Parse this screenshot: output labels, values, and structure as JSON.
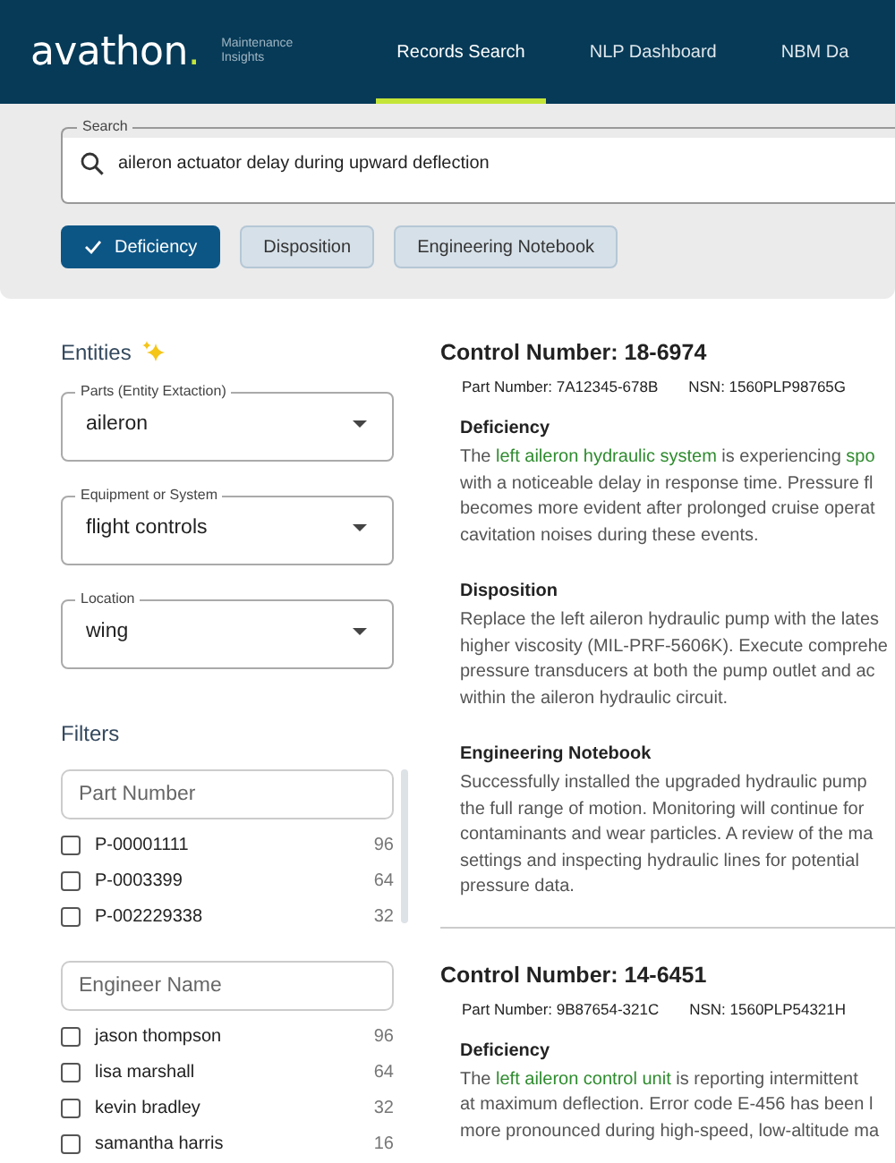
{
  "header": {
    "logo": "avathon",
    "logo_dot": ".",
    "subtitle_lines": [
      "Maintenance",
      "Insights"
    ],
    "nav": [
      {
        "label": "Records Search",
        "selected": true
      },
      {
        "label": "NLP Dashboard",
        "selected": false
      },
      {
        "label": "NBM Da",
        "selected": false
      }
    ]
  },
  "search": {
    "label": "Search",
    "value": "aileron actuator delay during upward deflection",
    "chips": [
      {
        "label": "Deficiency",
        "selected": true
      },
      {
        "label": "Disposition",
        "selected": false
      },
      {
        "label": "Engineering Notebook",
        "selected": false
      }
    ]
  },
  "entities": {
    "title": "Entities",
    "dropdowns": [
      {
        "label": "Parts (Entity Extaction)",
        "value": "aileron"
      },
      {
        "label": "Equipment or System",
        "value": "flight controls"
      },
      {
        "label": "Location",
        "value": "wing"
      }
    ]
  },
  "filters": {
    "title": "Filters",
    "groups": [
      {
        "placeholder": "Part Number",
        "options": [
          {
            "label": "P-00001111",
            "count": "96",
            "checked": false
          },
          {
            "label": "P-0003399",
            "count": "64",
            "checked": false
          },
          {
            "label": "P-002229338",
            "count": "32",
            "checked": false
          }
        ]
      },
      {
        "placeholder": "Engineer Name",
        "options": [
          {
            "label": "jason thompson",
            "count": "96",
            "checked": false
          },
          {
            "label": "lisa marshall",
            "count": "64",
            "checked": false
          },
          {
            "label": "kevin bradley",
            "count": "32",
            "checked": false
          },
          {
            "label": "samantha harris",
            "count": "16",
            "checked": false
          }
        ]
      }
    ]
  },
  "records": [
    {
      "title": "Control Number: 18-6974",
      "part_number": "Part Number: 7A12345-678B",
      "nsn": "NSN: 1560PLP98765G",
      "sections": [
        {
          "heading": "Deficiency",
          "lines": [
            [
              {
                "text": "The ",
                "highlight": false
              },
              {
                "text": "left aileron hydraulic system",
                "highlight": true
              },
              {
                "text": " is experiencing ",
                "highlight": false
              },
              {
                "text": "spo",
                "highlight": true
              }
            ],
            [
              {
                "text": "with a noticeable delay in response time. Pressure fl",
                "highlight": false
              }
            ],
            [
              {
                "text": "becomes more evident after prolonged cruise operat",
                "highlight": false
              }
            ],
            [
              {
                "text": "cavitation noises during these events.",
                "highlight": false
              }
            ]
          ]
        },
        {
          "heading": "Disposition",
          "lines": [
            [
              {
                "text": "Replace the left aileron hydraulic pump with the lates",
                "highlight": false
              }
            ],
            [
              {
                "text": "higher viscosity (MIL-PRF-5606K). Execute comprehe",
                "highlight": false
              }
            ],
            [
              {
                "text": "pressure transducers at both the pump outlet and ac",
                "highlight": false
              }
            ],
            [
              {
                "text": "within the aileron hydraulic circuit.",
                "highlight": false
              }
            ]
          ]
        },
        {
          "heading": "Engineering Notebook",
          "lines": [
            [
              {
                "text": "Successfully installed the upgraded hydraulic pump",
                "highlight": false
              }
            ],
            [
              {
                "text": "the full range of motion. Monitoring will continue for",
                "highlight": false
              }
            ],
            [
              {
                "text": "contaminants and wear particles. A review of the ma",
                "highlight": false
              }
            ],
            [
              {
                "text": "settings and inspecting hydraulic lines for potential",
                "highlight": false
              }
            ],
            [
              {
                "text": "pressure data.",
                "highlight": false
              }
            ]
          ]
        }
      ]
    },
    {
      "title": "Control Number: 14-6451",
      "part_number": "Part Number: 9B87654-321C",
      "nsn": "NSN: 1560PLP54321H",
      "sections": [
        {
          "heading": "Deficiency",
          "lines": [
            [
              {
                "text": "The ",
                "highlight": false
              },
              {
                "text": "left aileron control unit",
                "highlight": true
              },
              {
                "text": " is reporting intermittent",
                "highlight": false
              }
            ],
            [
              {
                "text": "at maximum deflection. Error code E-456 has been l",
                "highlight": false
              }
            ],
            [
              {
                "text": "more pronounced during high-speed, low-altitude ma",
                "highlight": false
              }
            ]
          ]
        }
      ]
    }
  ]
}
